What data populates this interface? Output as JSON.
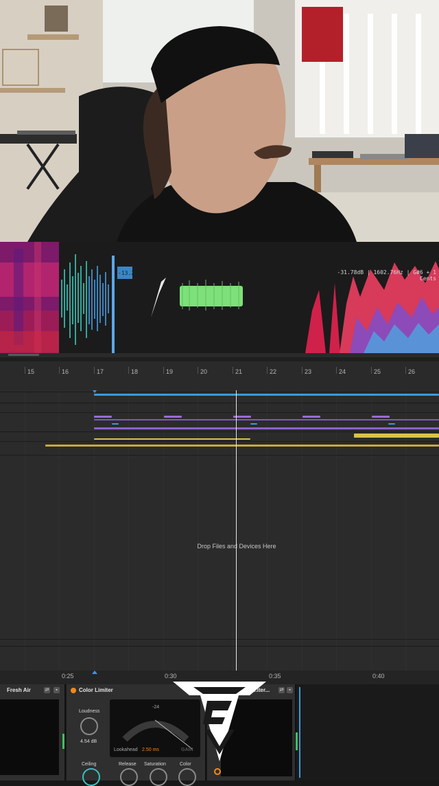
{
  "analyzer": {
    "clip_label": "-13.2LU",
    "readout": "-31.78dB | 1602.76Hz | G#6 + 1 Cents"
  },
  "ruler": {
    "bars": [
      "15",
      "16",
      "17",
      "18",
      "19",
      "20",
      "21",
      "22",
      "23",
      "24",
      "25",
      "26"
    ]
  },
  "arrangement": {
    "drop_text": "Drop Files and Devices Here"
  },
  "time_ruler": {
    "labels": [
      "0:25",
      "0:30",
      "0:35",
      "0:40"
    ]
  },
  "devices": {
    "fresh_air": {
      "title": "Fresh Air"
    },
    "color_limiter": {
      "title": "Color Limiter",
      "loudness_label": "Loudness",
      "loudness_value": "4.54 dB",
      "scale_value": "-24",
      "lookahead_label": "Lookahead",
      "lookahead_value": "2.50 ms",
      "gain_label": "GAIN",
      "ceiling_label": "Ceiling",
      "release_label": "Release",
      "saturation_label": "Saturation",
      "color_label": "Color"
    },
    "third_device": {
      "title": "...iter..."
    }
  },
  "colors": {
    "accent_orange": "#f28a1c",
    "clip_blue": "#3a9ad9",
    "clip_purple": "#9a6bd6",
    "clip_yellow": "#d9c24a",
    "meter_green": "#3fc160"
  }
}
